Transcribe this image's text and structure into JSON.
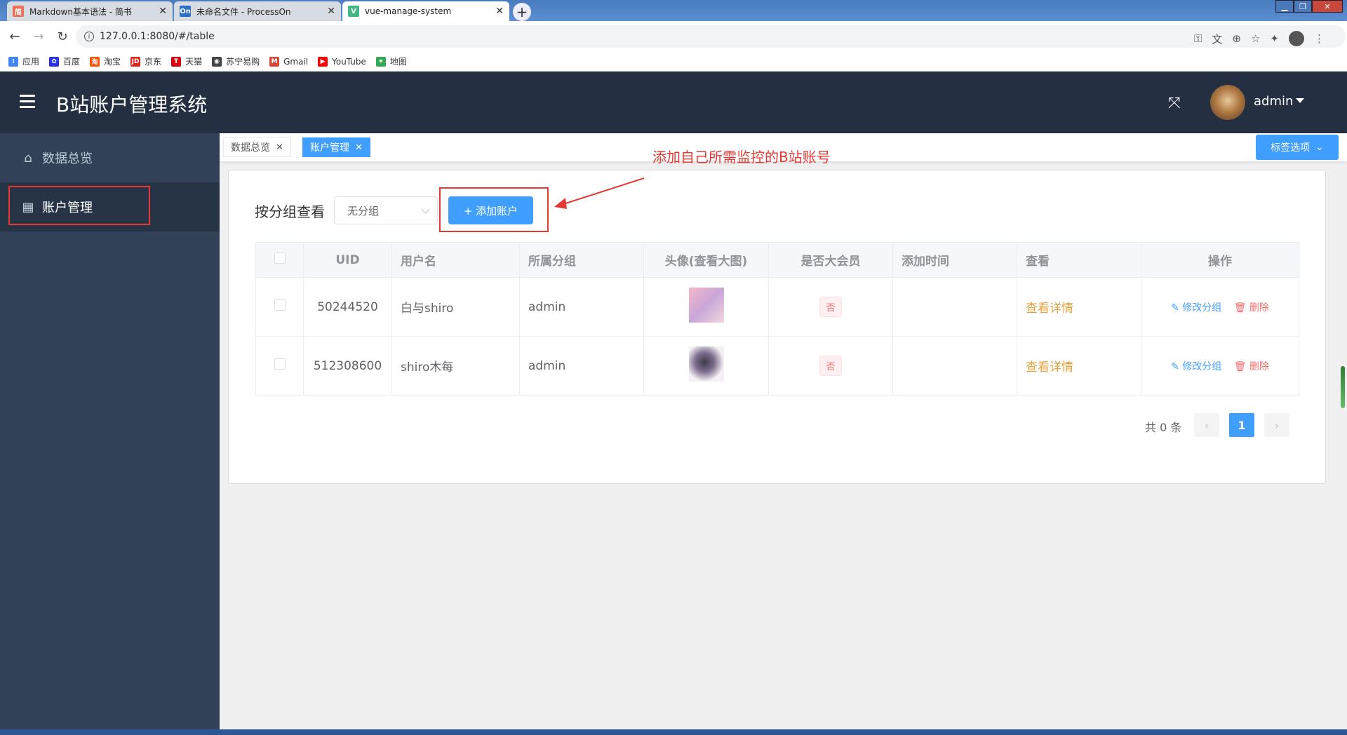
{
  "browser": {
    "tabs": [
      {
        "title": "Markdown基本语法 - 简书",
        "favicon": "简",
        "color": "#ea6f5a"
      },
      {
        "title": "未命名文件 - ProcessOn",
        "favicon": "On",
        "color": "#2a6fc9"
      },
      {
        "title": "vue-manage-system",
        "favicon": "V",
        "color": "#41b883"
      }
    ],
    "url": "127.0.0.1:8080/#/table",
    "bookmarks": [
      {
        "label": "应用",
        "icon": "apps-icon",
        "color": "#4285f4"
      },
      {
        "label": "百度",
        "icon": "baidu-icon",
        "color": "#2932e1"
      },
      {
        "label": "淘宝",
        "icon": "taobao-icon",
        "color": "#ff5000"
      },
      {
        "label": "京东",
        "icon": "jd-icon",
        "color": "#e1251b"
      },
      {
        "label": "天猫",
        "icon": "tmall-icon",
        "color": "#d8000f"
      },
      {
        "label": "苏宁易购",
        "icon": "suning-icon",
        "color": "#444444"
      },
      {
        "label": "Gmail",
        "icon": "gmail-icon",
        "color": "#d44638"
      },
      {
        "label": "YouTube",
        "icon": "youtube-icon",
        "color": "#ff0000"
      },
      {
        "label": "地图",
        "icon": "maps-icon",
        "color": "#34a853"
      }
    ]
  },
  "header": {
    "title": "B站账户管理系统",
    "username": "admin"
  },
  "sidebar": {
    "items": [
      {
        "label": "数据总览",
        "icon": "home-icon"
      },
      {
        "label": "账户管理",
        "icon": "grid-icon"
      }
    ]
  },
  "tags": {
    "items": [
      {
        "label": "数据总览"
      },
      {
        "label": "账户管理"
      }
    ],
    "options_label": "标签选项"
  },
  "annotation": "添加自己所需监控的B站账号",
  "toolbar": {
    "filter_label": "按分组查看",
    "group_value": "无分组",
    "add_label": "+ 添加账户"
  },
  "table": {
    "headers": [
      "UID",
      "用户名",
      "所属分组",
      "头像(查看大图)",
      "是否大会员",
      "添加时间",
      "查看",
      "操作"
    ],
    "rows": [
      {
        "uid": "50244520",
        "username": "白与shiro",
        "group": "admin",
        "vip": "否",
        "added": "",
        "view": "查看详情",
        "edit": "修改分组",
        "delete": "删除"
      },
      {
        "uid": "512308600",
        "username": "shiro木每",
        "group": "admin",
        "vip": "否",
        "added": "",
        "view": "查看详情",
        "edit": "修改分组",
        "delete": "删除"
      }
    ]
  },
  "pagination": {
    "total": "共 0 条",
    "current": "1",
    "prev": "‹",
    "next": "›"
  }
}
